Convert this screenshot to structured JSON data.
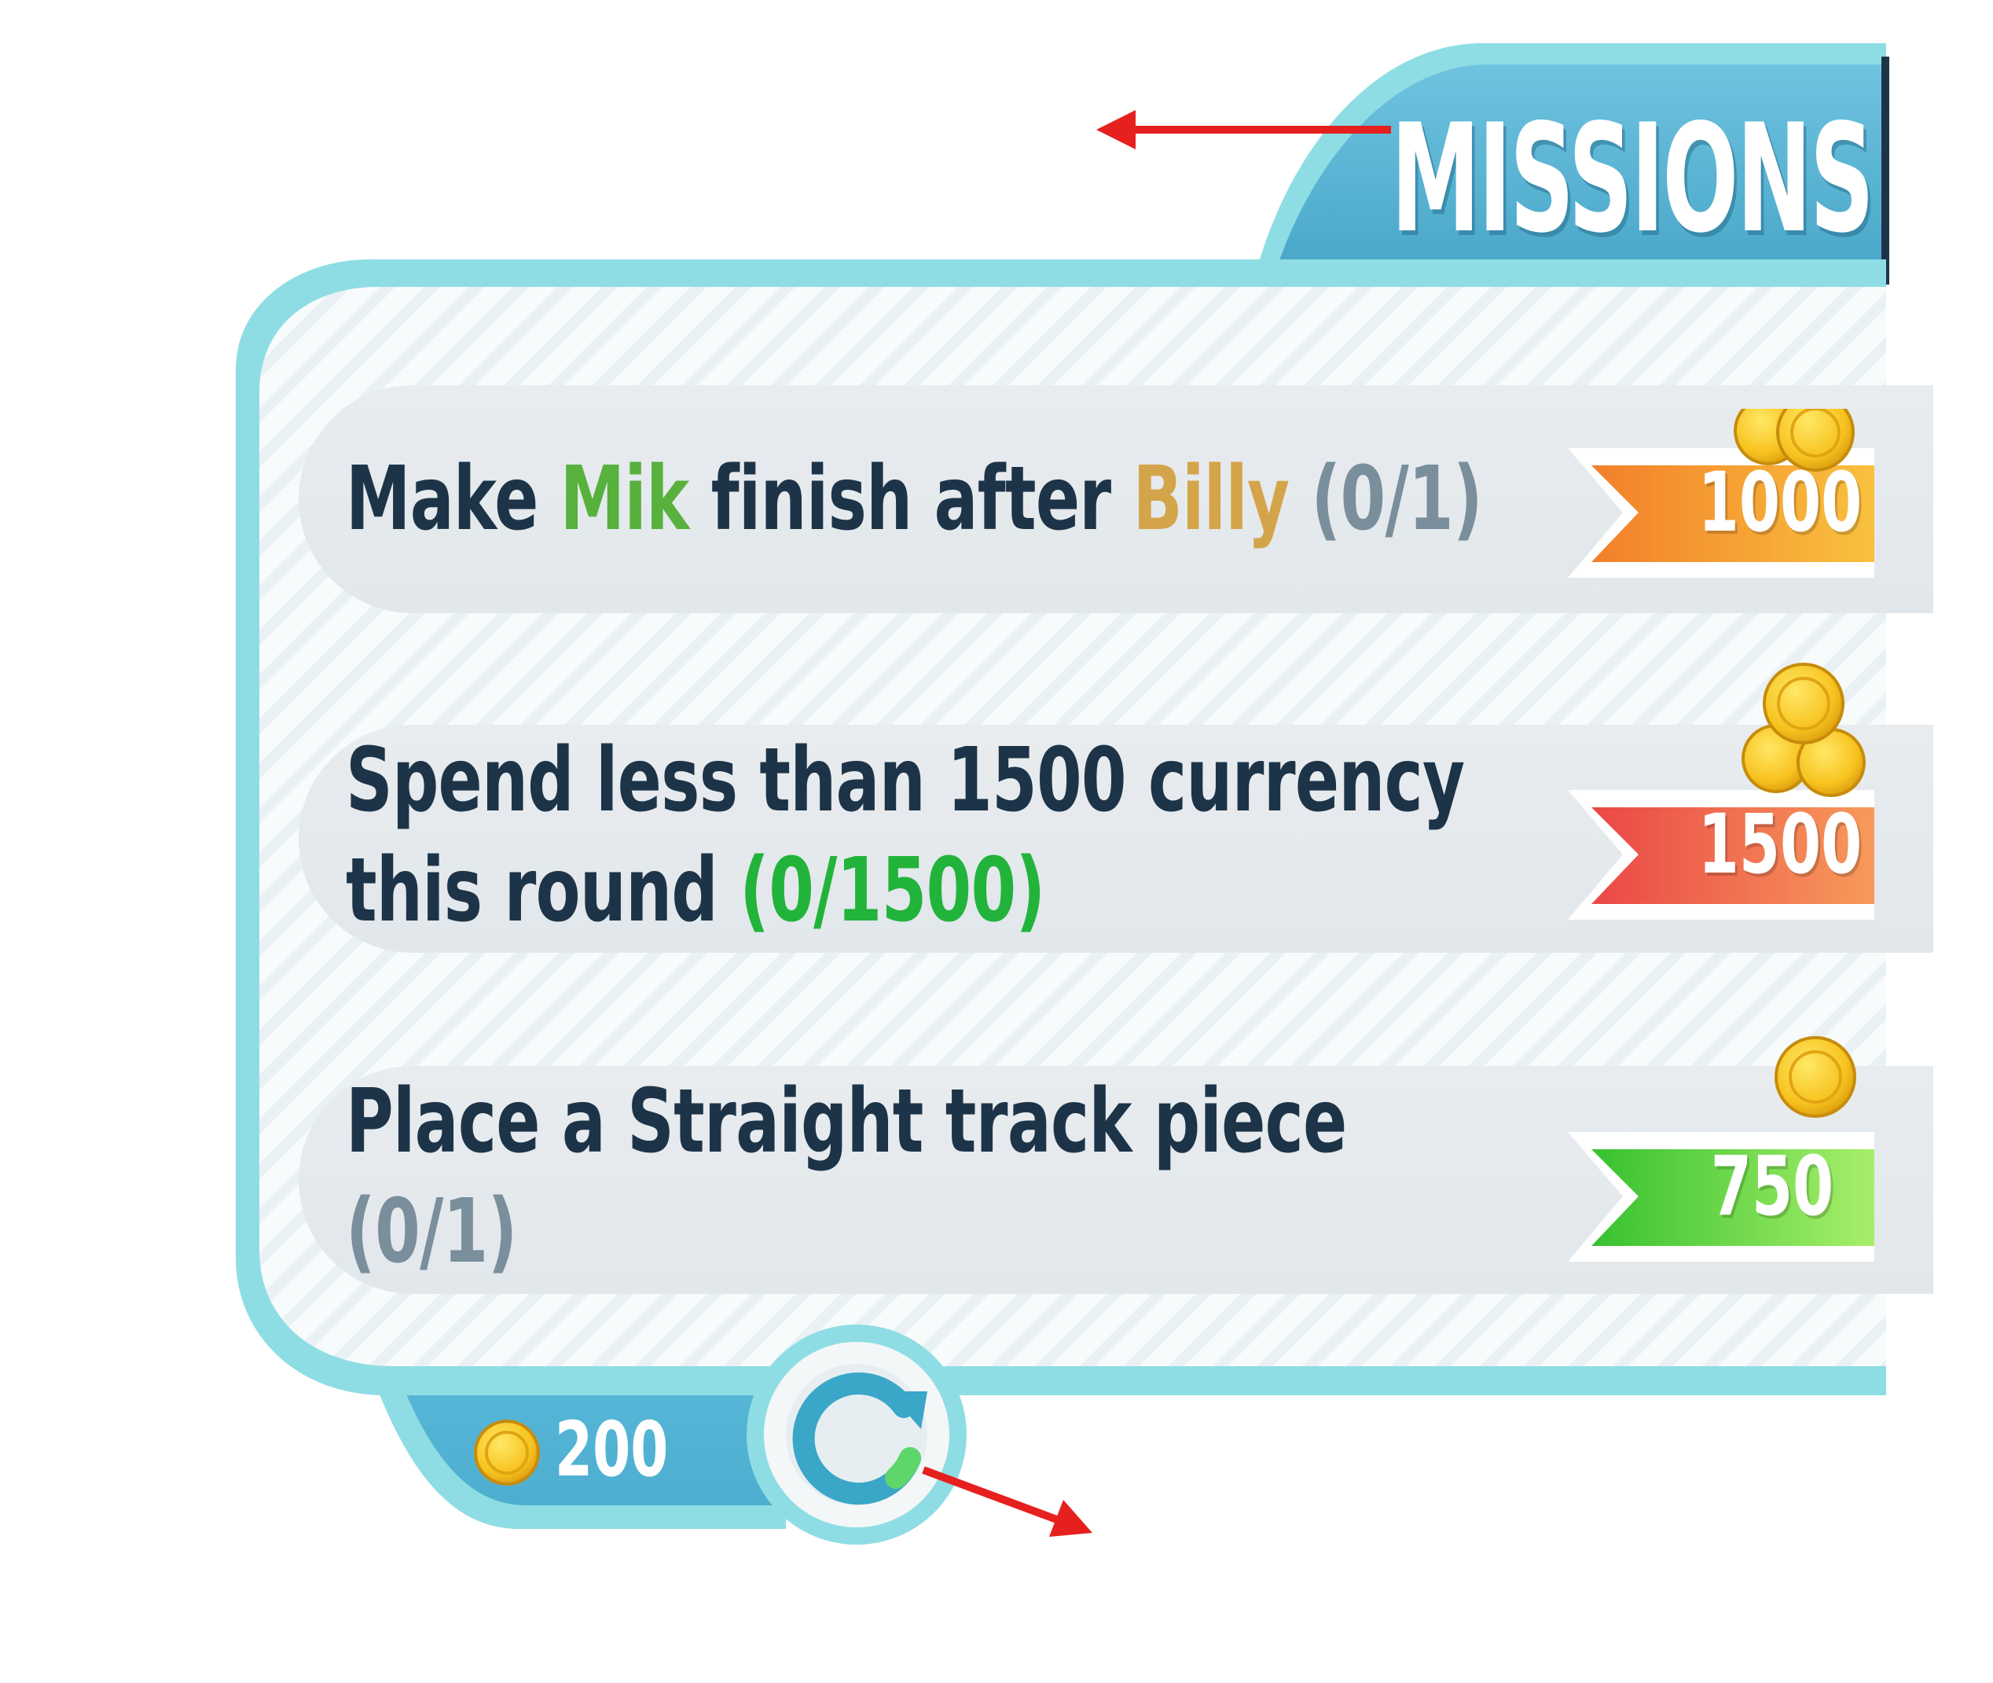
{
  "title": "MISSIONS",
  "missions": [
    {
      "parts": [
        {
          "text": "Make ",
          "style": "normal"
        },
        {
          "text": "Mik",
          "style": "green"
        },
        {
          "text": " finish after ",
          "style": "normal"
        },
        {
          "text": "Billy",
          "style": "gold"
        },
        {
          "text": " (0/1)",
          "style": "grey"
        }
      ],
      "reward": "1000",
      "reward_color": "#f7a13a"
    },
    {
      "line1": [
        {
          "text": "Spend less than 1500",
          "style": "bold"
        },
        {
          "text": " currency",
          "style": "normal"
        }
      ],
      "line2": [
        {
          "text": "this round ",
          "style": "normal"
        },
        {
          "text": "(0/1500)",
          "style": "bright-green"
        }
      ],
      "reward": "1500",
      "reward_color": "#f25b4c"
    },
    {
      "line1": [
        {
          "text": "Place a ",
          "style": "normal"
        },
        {
          "text": "Straight",
          "style": "bold"
        },
        {
          "text": " track piece",
          "style": "normal"
        }
      ],
      "line2": [
        {
          "text": "(0/1)",
          "style": "grey"
        }
      ],
      "reward": "750",
      "reward_color": "#4fcf3a"
    }
  ],
  "footer": {
    "coins": "200",
    "coin_icon": "coin-icon",
    "refresh_icon": "refresh-icon"
  },
  "colors": {
    "panel_border": "#7ed6dc",
    "tab_blue": "#56b3d4",
    "annotation_arrow": "#e6201e"
  }
}
